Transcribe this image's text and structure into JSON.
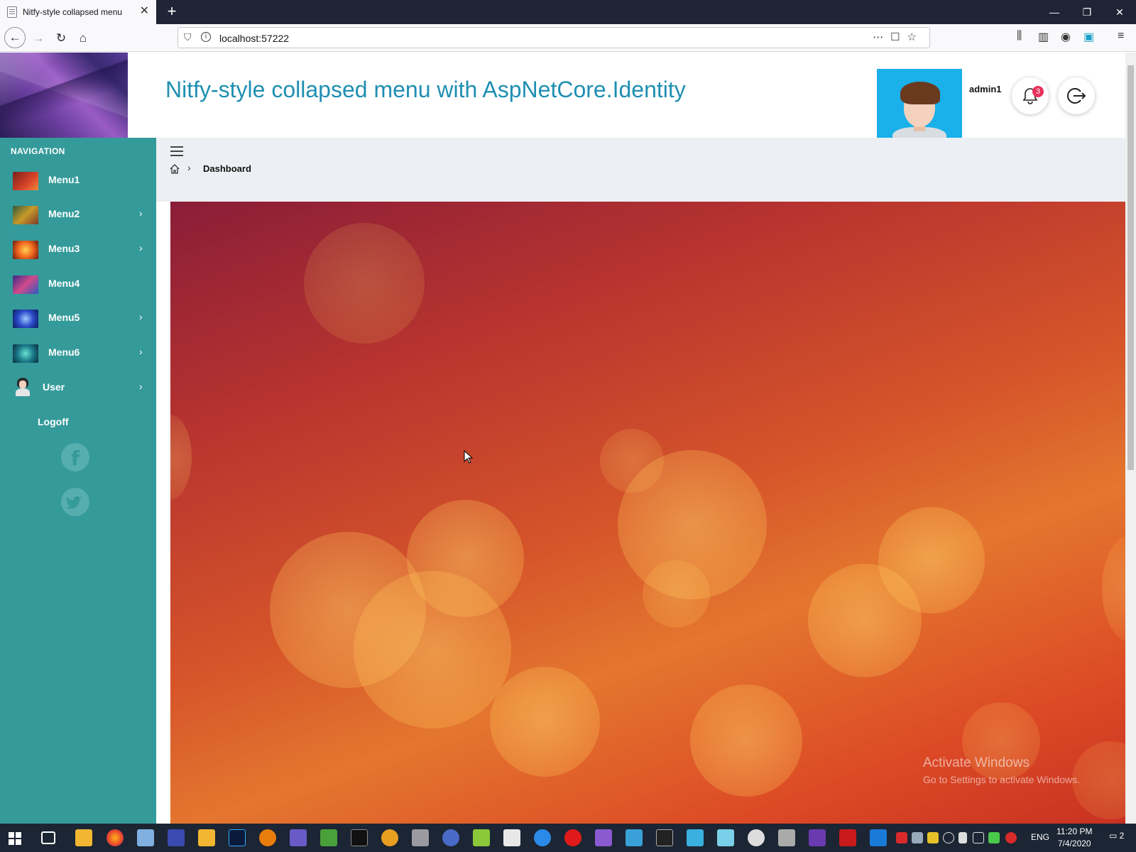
{
  "browser": {
    "tab_title": "Nitfy-style collapsed menu",
    "url": "localhost:57222"
  },
  "header": {
    "title": "Nitfy-style collapsed menu with AspNetCore.Identity",
    "username": "admin1",
    "notification_count": "3"
  },
  "sidebar": {
    "heading": "NAVIGATION",
    "items": [
      {
        "label": "Menu1",
        "has_submenu": false
      },
      {
        "label": "Menu2",
        "has_submenu": true
      },
      {
        "label": "Menu3",
        "has_submenu": true
      },
      {
        "label": "Menu4",
        "has_submenu": false
      },
      {
        "label": "Menu5",
        "has_submenu": true
      },
      {
        "label": "Menu6",
        "has_submenu": true
      },
      {
        "label": "User",
        "has_submenu": true
      }
    ],
    "logoff": "Logoff",
    "social": [
      "facebook-icon",
      "twitter-icon"
    ]
  },
  "breadcrumb": {
    "current": "Dashboard"
  },
  "watermark": {
    "title": "Activate Windows",
    "subtitle": "Go to Settings to activate Windows."
  },
  "taskbar": {
    "lang": "ENG",
    "time": "11:20 PM",
    "date": "7/4/2020",
    "notification_count": "2"
  },
  "colors": {
    "sidebar": "#359a9a",
    "title": "#1f8fb2",
    "badge": "#e8315b"
  }
}
